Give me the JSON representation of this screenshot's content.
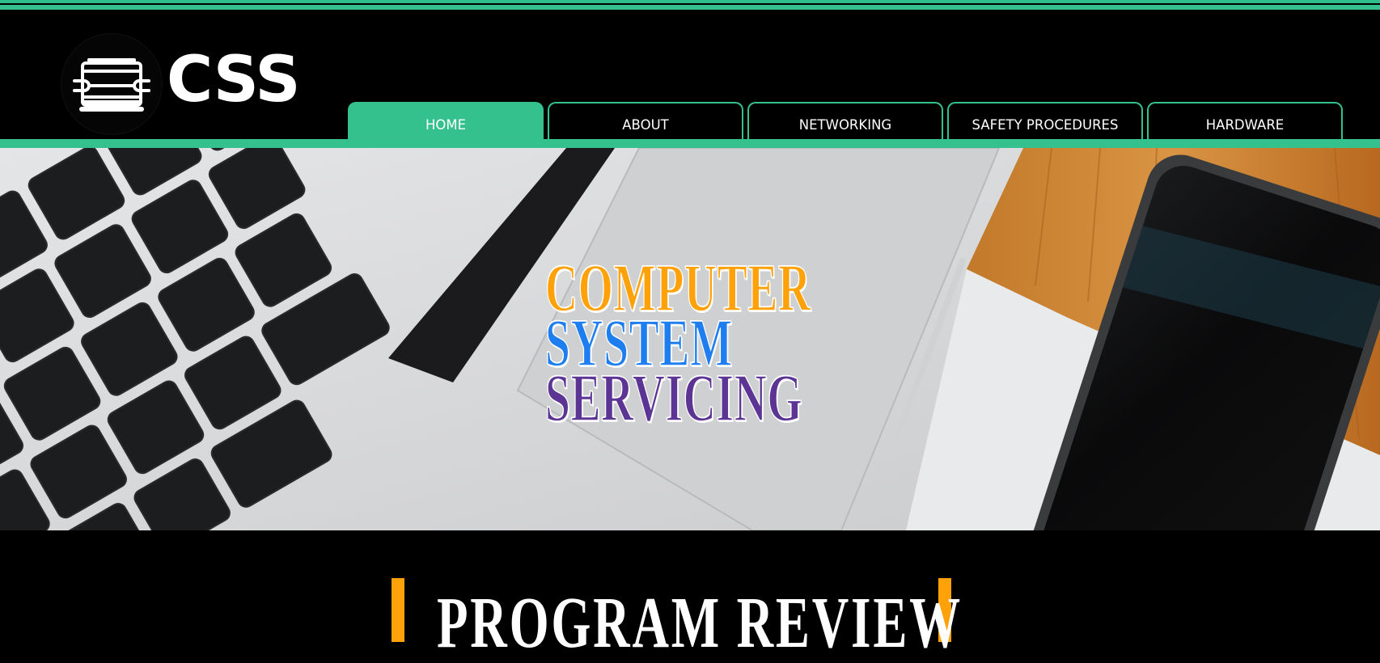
{
  "brand": {
    "logo_icon": "toolbox-wrench-icon",
    "name": "CSS"
  },
  "nav": {
    "items": [
      {
        "label": "HOME",
        "active": true
      },
      {
        "label": "ABOUT",
        "active": false
      },
      {
        "label": "NETWORKING",
        "active": false
      },
      {
        "label": "SAFETY PROCEDURES",
        "active": false
      },
      {
        "label": "HARDWARE",
        "active": false
      }
    ]
  },
  "hero": {
    "line1": "COMPUTER",
    "line2": "SYSTEM",
    "line3": "SERVICING",
    "background_image": "laptop-keyboard-and-smartphone-photo"
  },
  "section": {
    "title": "PROGRAM REVIEW"
  },
  "colors": {
    "accent_green": "#35c18d",
    "accent_orange": "#ffa20a",
    "title_orange": "#ffa20a",
    "title_blue": "#1e7ef0",
    "title_purple": "#5b3494",
    "background": "#000000"
  }
}
